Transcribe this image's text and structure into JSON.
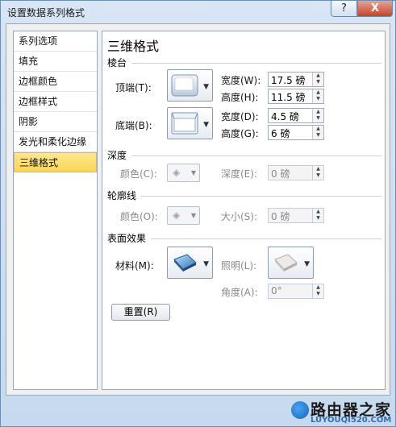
{
  "window": {
    "title": "设置数据系列格式",
    "help_label": "?",
    "close_label": "X"
  },
  "nav": {
    "items": [
      {
        "label": "系列选项"
      },
      {
        "label": "填充"
      },
      {
        "label": "边框颜色"
      },
      {
        "label": "边框样式"
      },
      {
        "label": "阴影"
      },
      {
        "label": "发光和柔化边缘"
      },
      {
        "label": "三维格式",
        "active": true
      }
    ]
  },
  "panel": {
    "title": "三维格式",
    "bevel": {
      "section": "棱台",
      "top_label": "顶端(T):",
      "bottom_label": "底端(B):",
      "top_width_label": "宽度(W):",
      "top_width_value": "17.5 磅",
      "top_height_label": "高度(H):",
      "top_height_value": "11.5 磅",
      "bottom_width_label": "宽度(D):",
      "bottom_width_value": "4.5 磅",
      "bottom_height_label": "高度(G):",
      "bottom_height_value": "6 磅"
    },
    "depth": {
      "section": "深度",
      "color_label": "颜色(C):",
      "depth_label": "深度(E):",
      "depth_value": "0 磅"
    },
    "contour": {
      "section": "轮廓线",
      "color_label": "颜色(O):",
      "size_label": "大小(S):",
      "size_value": "0 磅"
    },
    "surface": {
      "section": "表面效果",
      "material_label": "材料(M):",
      "lighting_label": "照明(L):",
      "angle_label": "角度(A):",
      "angle_value": "0°"
    },
    "reset_label": "重置(R)"
  },
  "watermark": {
    "cn": "路由器之家",
    "en": "LUYOUQI520.COM"
  },
  "colors": {
    "active_nav": "#fbd654",
    "frame": "#c7d9ee",
    "panel_bg": "#ffffff"
  }
}
